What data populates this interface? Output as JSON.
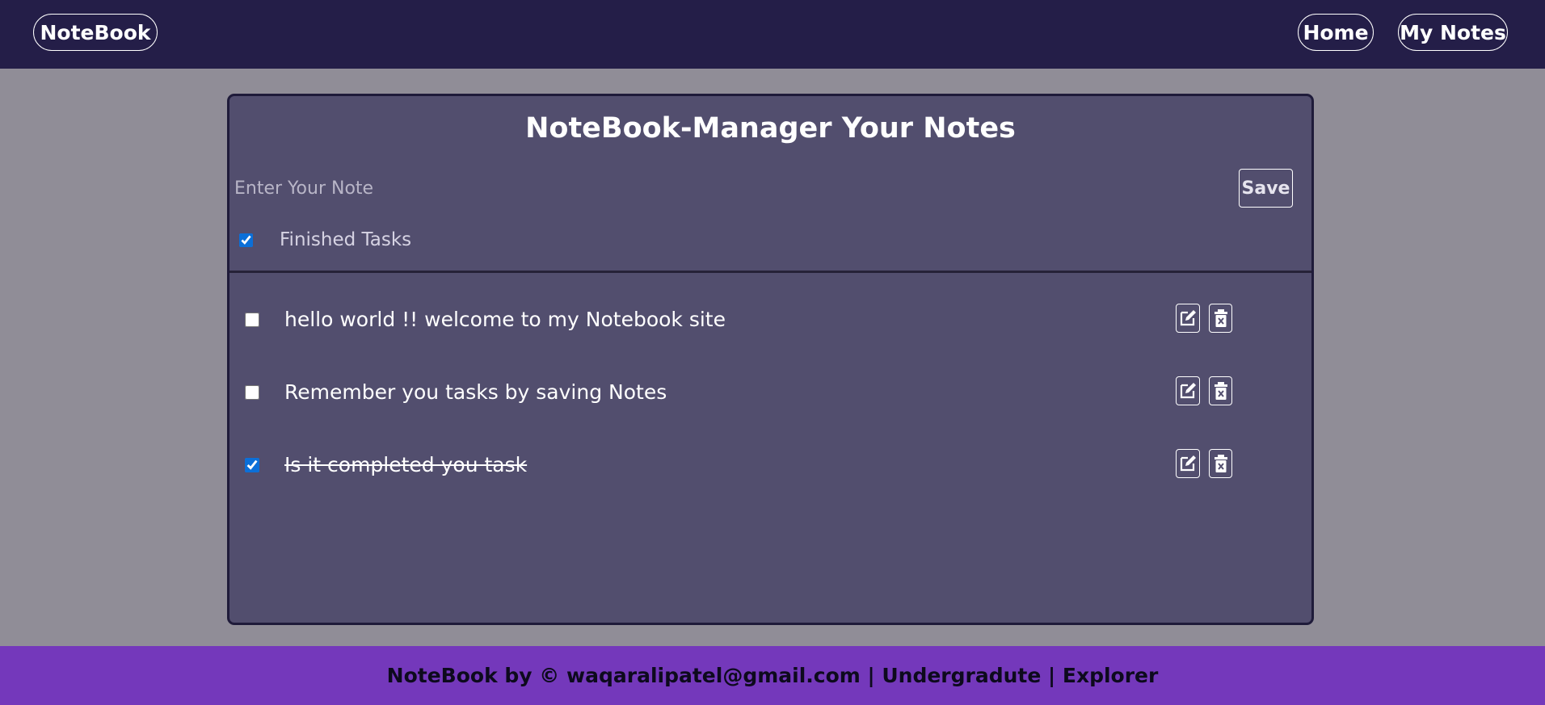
{
  "navbar": {
    "brand": "NoteBook",
    "links": [
      {
        "label": "Home"
      },
      {
        "label": "My Notes"
      }
    ]
  },
  "main": {
    "title": "NoteBook-Manager Your Notes",
    "input_placeholder": "Enter Your Note",
    "input_value": "",
    "save_label": "Save",
    "filter_label": "Finished Tasks",
    "filter_checked": true
  },
  "notes": [
    {
      "text": "hello world !! welcome to my Notebook site",
      "done": false
    },
    {
      "text": "Remember you tasks by saving Notes",
      "done": false
    },
    {
      "text": "Is it completed you task",
      "done": true
    }
  ],
  "icons": {
    "edit": "edit-icon",
    "delete": "trash-icon"
  },
  "footer": {
    "text": "NoteBook by © waqaralipatel@gmail.com | Undergradute | Explorer"
  },
  "colors": {
    "navbar": "#241e48",
    "card": "#524e6e",
    "footer": "#7438bb",
    "background": "#908d97"
  }
}
